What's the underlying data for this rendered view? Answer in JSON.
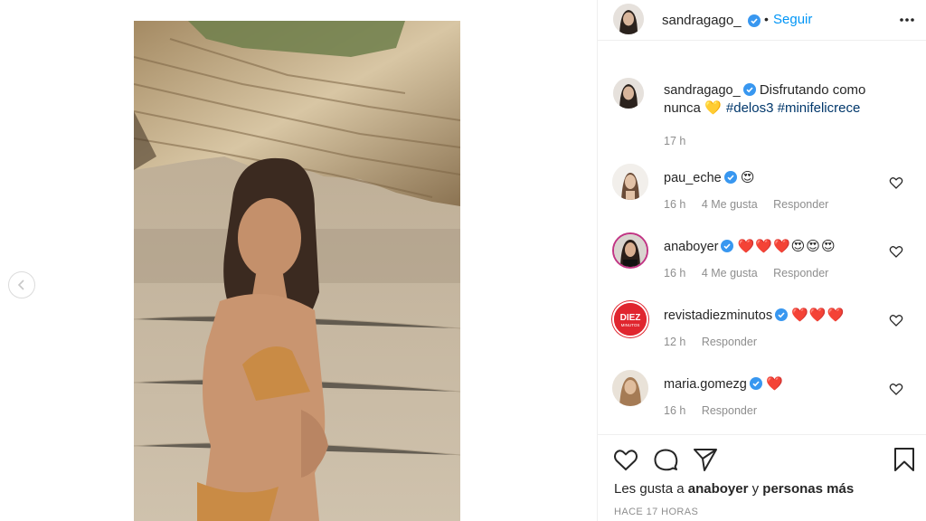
{
  "post": {
    "author": "sandragago_",
    "follow_label": "Seguir",
    "dot": "•",
    "caption_text": " Disfrutando como nunca ",
    "caption_heart": "💛",
    "hashtags": [
      "#delos3",
      "#minifelicrece"
    ],
    "caption_time": "17 h"
  },
  "comments": [
    {
      "user": "pau_eche",
      "text": "😍",
      "time": "16 h",
      "likes": "4 Me gusta",
      "reply": "Responder"
    },
    {
      "user": "anaboyer",
      "text": "❤️❤️❤️😍😍😍",
      "time": "16 h",
      "likes": "4 Me gusta",
      "reply": "Responder"
    },
    {
      "user": "revistadiezminutos",
      "text": "❤️❤️❤️",
      "time": "12 h",
      "reply": "Responder"
    },
    {
      "user": "maria.gomezg",
      "text": "❤️",
      "time": "16 h",
      "reply": "Responder"
    }
  ],
  "footer": {
    "likes_prefix": "Les gusta a ",
    "likes_user": "anaboyer",
    "likes_mid": " y ",
    "likes_others": "personas más",
    "ago": "HACE 17 HORAS"
  },
  "avatars": {
    "diez_label": "DIEZ",
    "diez_sub": "MINUTOS"
  },
  "icons": [
    "chevron-left-icon",
    "verified-badge-icon",
    "more-options-icon",
    "heart-icon",
    "comment-icon",
    "share-icon",
    "bookmark-icon"
  ],
  "colors": {
    "link": "#0095f6",
    "verified": "#3897f0",
    "muted": "#8e8e8e",
    "text": "#262626",
    "hashtag": "#00376b"
  }
}
